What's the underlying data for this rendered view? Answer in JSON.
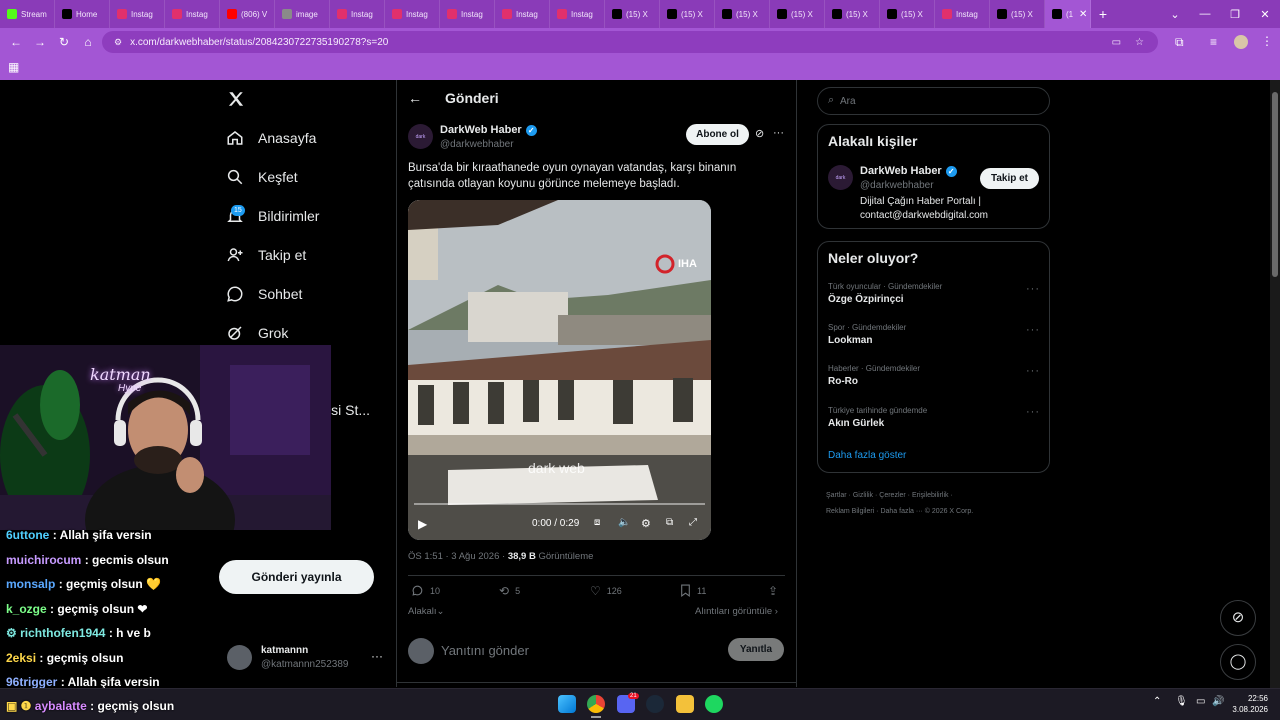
{
  "browser": {
    "tabs": [
      {
        "label": "Stream",
        "color": "#53fc18"
      },
      {
        "label": "Home",
        "color": "#000000"
      },
      {
        "label": "Instag",
        "color": "#e1306c"
      },
      {
        "label": "Instag",
        "color": "#e1306c"
      },
      {
        "label": "(806) V",
        "color": "#ff0000"
      },
      {
        "label": "image",
        "color": "#8a8a8a"
      },
      {
        "label": "Instag",
        "color": "#e1306c"
      },
      {
        "label": "Instag",
        "color": "#e1306c"
      },
      {
        "label": "Instag",
        "color": "#e1306c"
      },
      {
        "label": "Instag",
        "color": "#e1306c"
      },
      {
        "label": "Instag",
        "color": "#e1306c"
      },
      {
        "label": "(15) X",
        "color": "#000000"
      },
      {
        "label": "(15) X",
        "color": "#000000"
      },
      {
        "label": "(15) X",
        "color": "#000000"
      },
      {
        "label": "(15) X",
        "color": "#000000"
      },
      {
        "label": "(15) X",
        "color": "#000000"
      },
      {
        "label": "(15) X",
        "color": "#000000"
      },
      {
        "label": "Instag",
        "color": "#e1306c"
      },
      {
        "label": "(15) X",
        "color": "#000000"
      },
      {
        "label": "(1",
        "color": "#000000"
      }
    ],
    "url": "x.com/darkwebhaber/status/2084230722735190278?s=20"
  },
  "nav": {
    "items": [
      {
        "label": "Anasayfa"
      },
      {
        "label": "Keşfet"
      },
      {
        "label": "Bildirimler",
        "badge": "15"
      },
      {
        "label": "Takip et"
      },
      {
        "label": "Sohbet"
      },
      {
        "label": "Grok"
      },
      {
        "label": "i"
      },
      {
        "label": "isi St..."
      }
    ],
    "post_button": "Gönderi yayınla",
    "account": {
      "name": "katmannn",
      "handle": "@katmannn252389"
    }
  },
  "post": {
    "header_title": "Gönderi",
    "author": "DarkWeb Haber",
    "handle": "@darkwebhaber",
    "subscribe": "Abone ol",
    "text_line1": "Bursa'da bir kıraathanede oyun oynayan vatandaş, karşı binanın",
    "text_line2": "çatısında otlayan koyunu görünce melemeye başladı.",
    "video_time": "0:00 / 0:29",
    "video_brand": "IHA",
    "video_watermark": "dark web",
    "timestamp": "ÖS 1:51 · 3 Ağu 2026 ·",
    "views_count": "38,9 B",
    "views_label": "Görüntüleme",
    "replies": "10",
    "reposts": "5",
    "likes": "126",
    "bookmarks": "11",
    "relevant": "Alakalı",
    "quotes": "Alıntıları görüntüle",
    "reply_placeholder": "Yanıtını gönder",
    "reply_button": "Yanıtla"
  },
  "sidebar": {
    "search_placeholder": "Ara",
    "people_title": "Alakalı kişiler",
    "person": {
      "name": "DarkWeb Haber",
      "handle": "@darkwebhaber",
      "bio_line1": "Dijital Çağın Haber Portalı |",
      "bio_line2": "contact@darkwebdigital.com",
      "follow": "Takip et"
    },
    "trends_title": "Neler oluyor?",
    "trends": [
      {
        "context": "Türk oyuncular · Gündemdekiler",
        "name": "Özge Özpirinçci"
      },
      {
        "context": "Spor · Gündemdekiler",
        "name": "Lookman"
      },
      {
        "context": "Haberler · Gündemdekiler",
        "name": "Ro-Ro"
      },
      {
        "context": "Türkiye tarihinde gündemde",
        "name": "Akın Gürlek"
      }
    ],
    "show_more": "Daha fazla göster",
    "footer_line1": "Şartlar · Gizlilik · Çerezler · Erişilebilirlik ·",
    "footer_line2": "Reklam Bilgileri · Daha fazla ··· © 2026 X Corp."
  },
  "stream": {
    "overlay_text": "katman",
    "overlay_sub": "Hype",
    "chat": [
      {
        "user": "6uttone",
        "color": "#4fd1ff",
        "msg": ": Allah şifa versin"
      },
      {
        "user": "muichirocum",
        "color": "#c79bff",
        "msg": ": gecmis olsun"
      },
      {
        "user": "monsalp",
        "color": "#5aa8ff",
        "msg": ": geçmiş olsun 💛"
      },
      {
        "user": "k_ozge",
        "color": "#7dff8a",
        "msg": ": geçmiş olsun ❤"
      },
      {
        "user": "richthofen1944",
        "color": "#7ee8e0",
        "msg": ": h ve b"
      },
      {
        "user": "2eksi",
        "color": "#ffd84a",
        "msg": ": geçmiş olsun"
      },
      {
        "user": "96trigger",
        "color": "#8fb0ff",
        "msg": ": Allah şifa versin"
      },
      {
        "user": "aybalatte",
        "color": "#d78bff",
        "msg": ": geçmiş olsun"
      }
    ]
  },
  "taskbar": {
    "time": "22:56",
    "date": "3.08.2026",
    "discord_badge": "21"
  }
}
